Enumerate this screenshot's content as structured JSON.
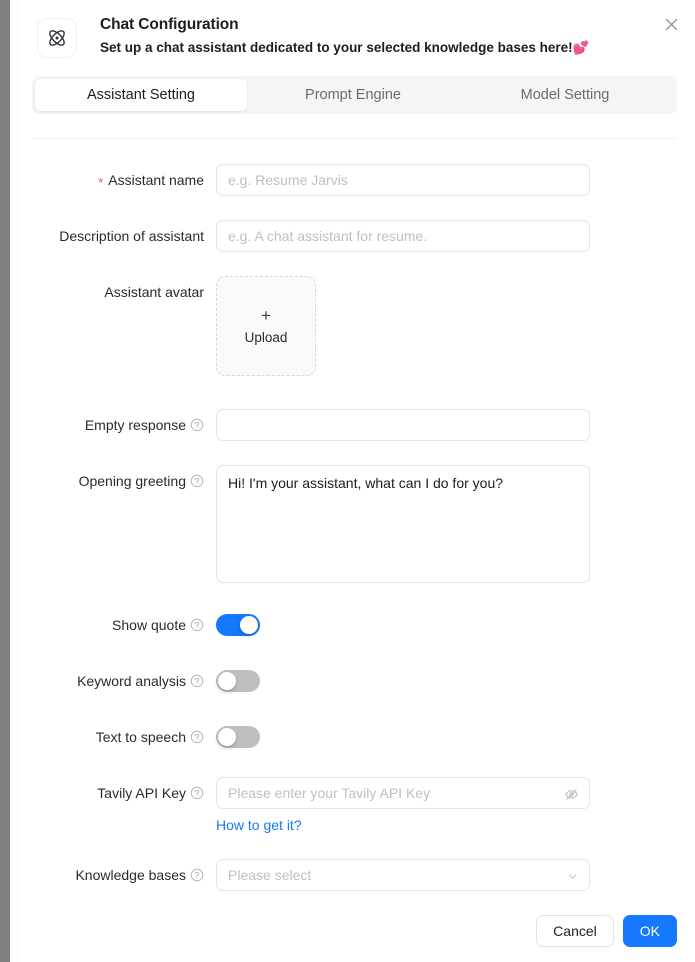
{
  "backdrop": {
    "color": "#808080"
  },
  "header": {
    "logo_icon": "atom-icon",
    "title": "Chat Configuration",
    "subtitle": "Set up a chat assistant dedicated to your selected knowledge bases here!",
    "subtitle_emoji": "💕",
    "close_icon": "close-icon"
  },
  "tabs": {
    "active_index": 0,
    "items": [
      {
        "label": "Assistant Setting"
      },
      {
        "label": "Prompt Engine"
      },
      {
        "label": "Model Setting"
      }
    ]
  },
  "form": {
    "assistant_name": {
      "label": "Assistant name",
      "required_marker": "*",
      "placeholder": "e.g. Resume Jarvis",
      "value": ""
    },
    "description": {
      "label": "Description of assistant",
      "placeholder": "e.g. A chat assistant for resume.",
      "value": ""
    },
    "avatar": {
      "label": "Assistant avatar",
      "plus_icon": "plus-icon",
      "upload_label": "Upload"
    },
    "empty_response": {
      "label": "Empty response",
      "help_icon": "question-circle-icon",
      "placeholder": "",
      "value": ""
    },
    "opening_greeting": {
      "label": "Opening greeting",
      "help_icon": "question-circle-icon",
      "value": "Hi! I'm your assistant, what can I do for you?"
    },
    "show_quote": {
      "label": "Show quote",
      "help_icon": "question-circle-icon",
      "state": "on"
    },
    "keyword_analysis": {
      "label": "Keyword analysis",
      "help_icon": "question-circle-icon",
      "state": "off"
    },
    "text_to_speech": {
      "label": "Text to speech",
      "help_icon": "question-circle-icon",
      "state": "off"
    },
    "tavily_api_key": {
      "label": "Tavily API Key",
      "help_icon": "question-circle-icon",
      "placeholder": "Please enter your Tavily API Key",
      "value": "",
      "visibility_icon": "eye-invisible-icon",
      "link_label": "How to get it?"
    },
    "knowledge_bases": {
      "label": "Knowledge bases",
      "help_icon": "question-circle-icon",
      "placeholder": "Please select",
      "value": "",
      "arrow_icon": "chevron-down-icon"
    }
  },
  "footer": {
    "cancel_label": "Cancel",
    "ok_label": "OK"
  },
  "colors": {
    "primary": "#1677ff",
    "required": "#ff4d4f",
    "link": "#1677ff",
    "switch_off": "#bfbfbf"
  }
}
